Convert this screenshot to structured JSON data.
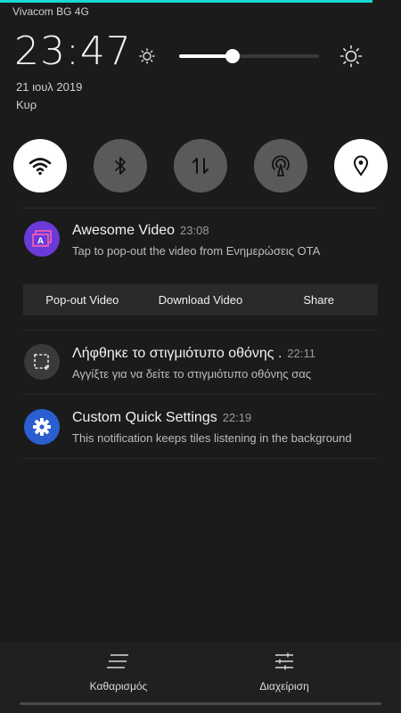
{
  "status_bar": {
    "carrier": "Vivacom BG 4G"
  },
  "header": {
    "time": "23:47",
    "date": "21 ιουλ 2019",
    "weekday": "Κυρ"
  },
  "brightness": {
    "level": 0.38
  },
  "quick_tiles": [
    {
      "name": "wifi",
      "active": true,
      "icon": "wifi-icon"
    },
    {
      "name": "bluetooth",
      "active": false,
      "icon": "bluetooth-icon"
    },
    {
      "name": "mobile-data",
      "active": false,
      "icon": "data-transfer-icon"
    },
    {
      "name": "hotspot",
      "active": false,
      "icon": "hotspot-icon"
    },
    {
      "name": "location",
      "active": true,
      "icon": "location-icon"
    }
  ],
  "notifications": [
    {
      "title": "Awesome Video",
      "time": "23:08",
      "body": "Tap to pop-out the video from Ενημερώσεις ΟΤΑ",
      "icon": "video-app-icon",
      "icon_color": "#6a3bd8",
      "actions": [
        "Pop-out Video",
        "Download Video",
        "Share"
      ]
    },
    {
      "title": "Λήφθηκε το στιγμιότυπο οθόνης .",
      "time": "22:11",
      "body": "Αγγίξτε για να δείτε το στιγμιότυπο οθόνης σας",
      "icon": "screenshot-icon",
      "icon_color": "#3a3a3a"
    },
    {
      "title": "Custom Quick Settings",
      "time": "22:19",
      "body": "This notification keeps tiles listening in the background",
      "icon": "gear-icon",
      "icon_color": "#2b5fd0"
    }
  ],
  "bottom": {
    "clear_label": "Καθαρισμός",
    "manage_label": "Διαχείριση"
  },
  "colors": {
    "accent": "#19d9d3",
    "background": "#1b1b1b"
  }
}
